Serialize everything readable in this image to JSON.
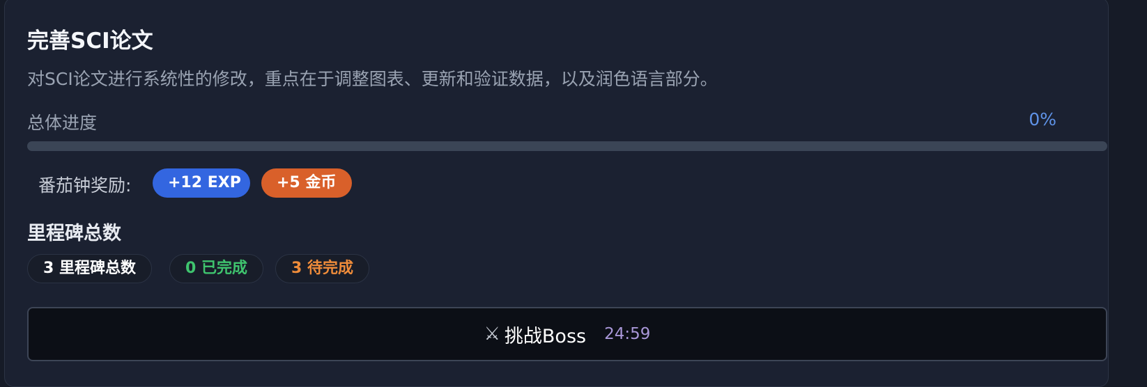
{
  "task": {
    "title": "完善SCI论文",
    "description": "对SCI论文进行系统性的修改，重点在于调整图表、更新和验证数据，以及润色语言部分。"
  },
  "progress": {
    "label": "总体进度",
    "value_text": "0%",
    "value": 0
  },
  "rewards": {
    "label": "番茄钟奖励:",
    "exp": "+12 EXP",
    "gold": "+5 金币"
  },
  "milestones": {
    "title": "里程碑总数",
    "total": "3 里程碑总数",
    "completed": "0 已完成",
    "pending": "3 待完成"
  },
  "boss": {
    "icon": "crossed-swords-icon",
    "label": "挑战Boss",
    "timer": "24:59"
  },
  "colors": {
    "accent_blue": "#3366e0",
    "accent_orange": "#d9602a",
    "completed_green": "#3fc46e",
    "pending_orange": "#ef8c3a",
    "timer_purple": "#a997d8"
  }
}
